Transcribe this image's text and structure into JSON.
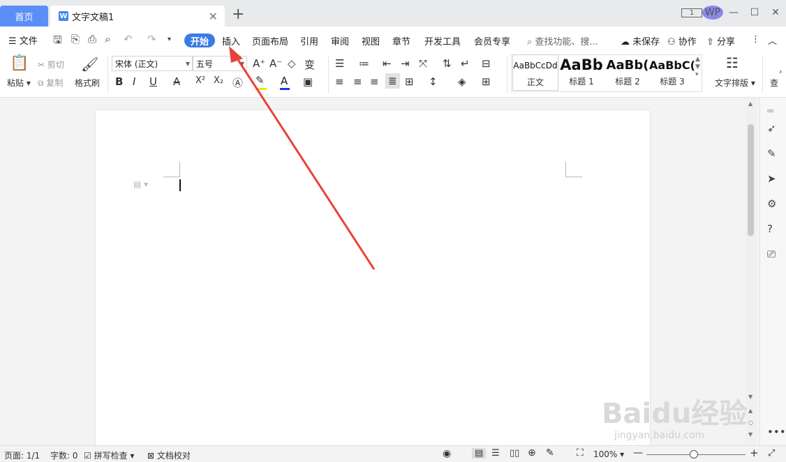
{
  "tabs": {
    "home": "首页",
    "document": "文字文稿1",
    "doc_icon": "W",
    "close": "✕",
    "new": "+"
  },
  "window": {
    "avatar": "WP",
    "reading_mode_icon": "1",
    "min": "—",
    "max": "☐",
    "close": "✕"
  },
  "menu": {
    "file": "文件",
    "items": [
      "开始",
      "插入",
      "页面布局",
      "引用",
      "审阅",
      "视图",
      "章节",
      "开发工具",
      "会员专享"
    ],
    "search_placeholder": "查找功能、搜...",
    "unsaved": "未保存",
    "collaborate": "协作",
    "share": "分享"
  },
  "ribbon": {
    "paste": "粘贴",
    "cut": "剪切",
    "copy": "复制",
    "format_painter": "格式刷",
    "font_name": "宋体 (正文)",
    "font_size": "五号",
    "bold": "B",
    "italic": "I",
    "underline": "U",
    "superscript": "X²",
    "subscript": "X₂",
    "font_color": "A",
    "styles": [
      {
        "preview": "AaBbCcDd",
        "name": "正文"
      },
      {
        "preview": "AaBb",
        "name": "标题 1"
      },
      {
        "preview": "AaBb(",
        "name": "标题 2"
      },
      {
        "preview": "AaBbC(",
        "name": "标题 3"
      }
    ],
    "text_layout": "文字排版",
    "find_cut": "查"
  },
  "status": {
    "page": "页面: 1/1",
    "words": "字数: 0",
    "spellcheck": "拼写检查",
    "proofread": "文档校对",
    "zoom": "100%",
    "zoom_percent": 100
  },
  "watermark": {
    "logo": "Baidu经验",
    "url": "jingyan.baidu.com"
  },
  "colors": {
    "accent": "#3c7be6",
    "home_tab": "#5b8ef7",
    "arrow": "#e8423b",
    "highlight": "#f5e400",
    "font_red": "#d22"
  }
}
